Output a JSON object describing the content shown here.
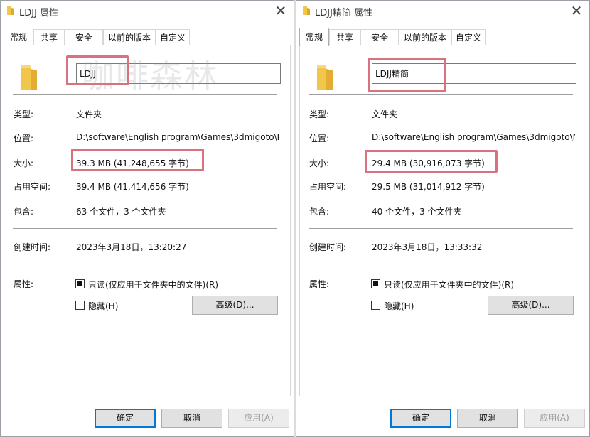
{
  "watermark": "咖啡森林",
  "colors": {
    "highlight": "#d9717f",
    "accent": "#0078d7",
    "folder": "#f2c64b"
  },
  "dialogs": [
    {
      "title": "LDJJ 属性",
      "tabs": [
        "常规",
        "共享",
        "安全",
        "以前的版本",
        "自定义"
      ],
      "active_tab": "常规",
      "name": "LDJJ",
      "labels": {
        "type": "类型:",
        "location": "位置:",
        "size": "大小:",
        "disk_size": "占用空间:",
        "contains": "包含:",
        "created": "创建时间:",
        "attributes": "属性:"
      },
      "values": {
        "type": "文件夹",
        "location": "D:\\software\\English program\\Games\\3dmigoto\\M",
        "size": "39.3 MB (41,248,655 字节)",
        "disk_size": "39.4 MB (41,414,656 字节)",
        "contains": "63 个文件，3 个文件夹",
        "created": "2023年3月18日，13:20:27"
      },
      "readonly_label": "只读(仅应用于文件夹中的文件)(R)",
      "readonly_checked": true,
      "hidden_label": "隐藏(H)",
      "hidden_checked": false,
      "advanced_button": "高级(D)...",
      "ok": "确定",
      "cancel": "取消",
      "apply": "应用(A)",
      "close_glyph": "✕"
    },
    {
      "title": "LDJJ精简 属性",
      "tabs": [
        "常规",
        "共享",
        "安全",
        "以前的版本",
        "自定义"
      ],
      "active_tab": "常规",
      "name": "LDJJ精简",
      "labels": {
        "type": "类型:",
        "location": "位置:",
        "size": "大小:",
        "disk_size": "占用空间:",
        "contains": "包含:",
        "created": "创建时间:",
        "attributes": "属性:"
      },
      "values": {
        "type": "文件夹",
        "location": "D:\\software\\English program\\Games\\3dmigoto\\M",
        "size": "29.4 MB (30,916,073 字节)",
        "disk_size": "29.5 MB (31,014,912 字节)",
        "contains": "40 个文件，3 个文件夹",
        "created": "2023年3月18日，13:33:32"
      },
      "readonly_label": "只读(仅应用于文件夹中的文件)(R)",
      "readonly_checked": true,
      "hidden_label": "隐藏(H)",
      "hidden_checked": false,
      "advanced_button": "高级(D)...",
      "ok": "确定",
      "cancel": "取消",
      "apply": "应用(A)",
      "close_glyph": "✕"
    }
  ]
}
